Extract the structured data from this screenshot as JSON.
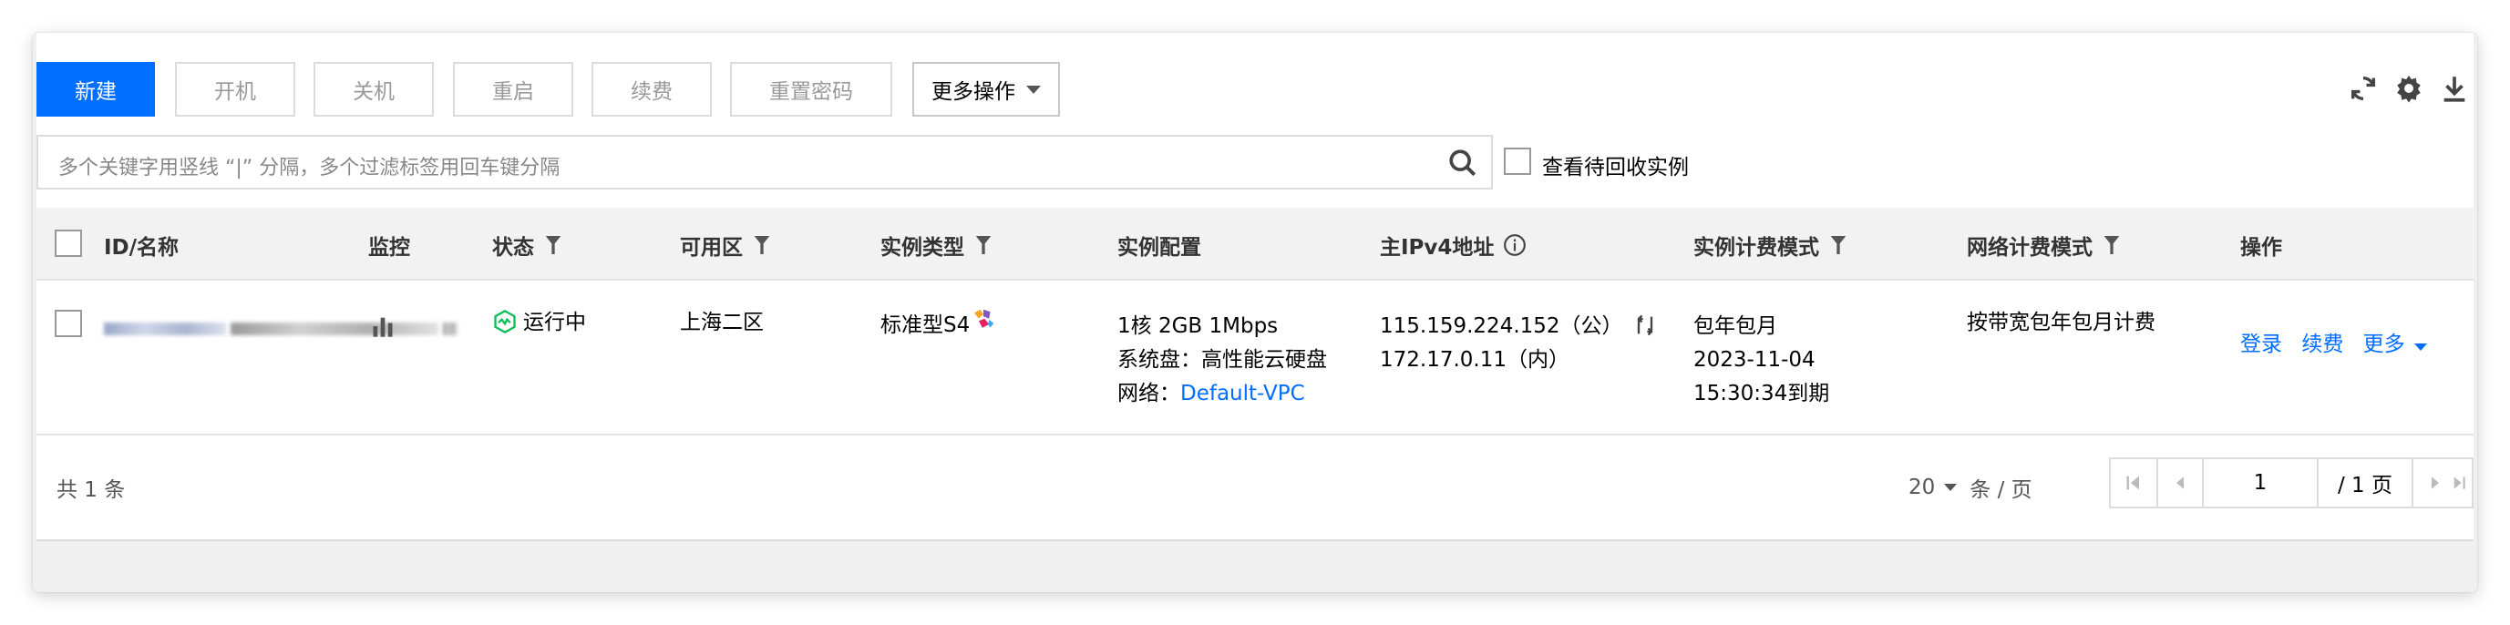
{
  "toolbar": {
    "new_label": "新建",
    "start_label": "开机",
    "shutdown_label": "关机",
    "restart_label": "重启",
    "renew_label": "续费",
    "reset_password_label": "重置密码",
    "more_actions_label": "更多操作",
    "icons": [
      "refresh-icon",
      "settings-icon",
      "download-icon"
    ]
  },
  "search": {
    "placeholder": "多个关键字用竖线 “|” 分隔，多个过滤标签用回车键分隔",
    "recycle_checkbox_label": "查看待回收实例"
  },
  "table": {
    "columns": {
      "id_name": "ID/名称",
      "monitor": "监控",
      "status": "状态",
      "zone": "可用区",
      "instance_type": "实例类型",
      "config": "实例配置",
      "ipv4": "主IPv4地址",
      "billing_mode": "实例计费模式",
      "network_billing": "网络计费模式",
      "actions": "操作"
    },
    "rows": [
      {
        "status": "运行中",
        "zone": "上海二区",
        "instance_type": "标准型S4",
        "config_line1": "1核 2GB 1Mbps",
        "config_line2": "系统盘：高性能云硬盘",
        "config_network_label": "网络：",
        "config_network_value": "Default-VPC",
        "ip_public": "115.159.224.152（公）",
        "ip_private": "172.17.0.11（内）",
        "billing_line1": "包年包月",
        "billing_line2": "2023-11-04",
        "billing_line3": "15:30:34到期",
        "network_billing": "按带宽包年包月计费",
        "action_login": "登录",
        "action_renew": "续费",
        "action_more": "更多"
      }
    ]
  },
  "footer": {
    "total_text": "共 1 条",
    "page_size": "20",
    "page_size_unit": "条 / 页",
    "current_page": "1",
    "total_pages_text": "/ 1 页"
  },
  "colors": {
    "primary": "#006eff",
    "running": "#0abf5b"
  }
}
